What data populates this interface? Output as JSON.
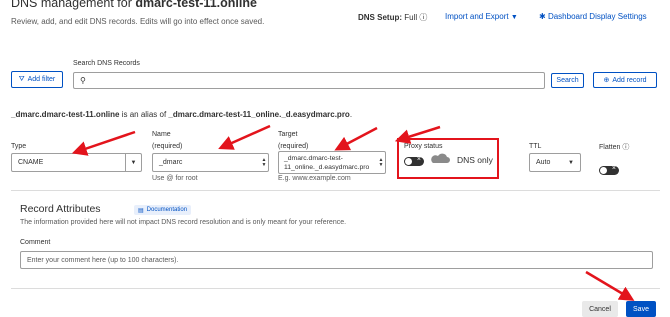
{
  "header": {
    "title_prefix": "DNS management for ",
    "title_domain": "dmarc-test-11.online",
    "subtitle": "Review, add, and edit DNS records. Edits will go into effect once saved.",
    "dns_setup_label": "DNS Setup:",
    "dns_setup_value": "Full",
    "import_export": "Import and Export",
    "dashboard_settings": "Dashboard Display Settings"
  },
  "search": {
    "label": "Search DNS Records",
    "placeholder": "",
    "add_filter": "Add filter",
    "search_button": "Search",
    "add_record": "Add record"
  },
  "alias_note": {
    "prefix": "_dmarc.dmarc-test-11.online",
    "middle": " is an alias of ",
    "target": "_dmarc.dmarc-test-11_online._d.easydmarc.pro",
    "suffix": "."
  },
  "form": {
    "type_label": "Type",
    "type_value": "CNAME",
    "name_label_1": "Name",
    "name_label_2": "(required)",
    "name_value": "_dmarc",
    "name_hint": "Use @ for root",
    "target_label_1": "Target",
    "target_label_2": "(required)",
    "target_value_1": "_dmarc.dmarc-test-",
    "target_value_2": "11_online._d.easydmarc.pro",
    "target_hint": "E.g. www.example.com",
    "proxy_label": "Proxy status",
    "proxy_value": "DNS only",
    "ttl_label": "TTL",
    "ttl_value": "Auto",
    "flatten_label": "Flatten"
  },
  "attributes": {
    "heading": "Record Attributes",
    "doc_badge": "Documentation",
    "description": "The information provided here will not impact DNS record resolution and is only meant for your reference.",
    "comment_label": "Comment",
    "comment_placeholder": "Enter your comment here (up to 100 characters)."
  },
  "footer": {
    "cancel": "Cancel",
    "save": "Save"
  },
  "colors": {
    "accent": "#0051c3",
    "annotation": "#e3141c"
  }
}
